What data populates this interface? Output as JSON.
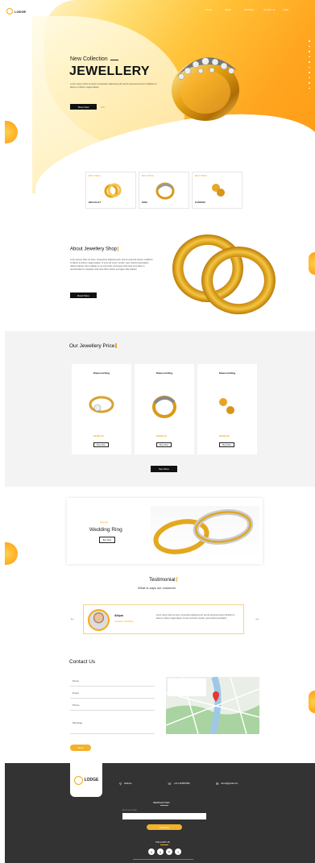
{
  "header": {
    "logo_text": "LODGE",
    "nav": [
      "Home",
      "About",
      "Jewellery",
      "Contact us",
      "Login"
    ]
  },
  "hero": {
    "small_title": "New Collection",
    "title": "JEWELLERY",
    "description": "Lorem ipsum dolor sit amet consectetur adipiscing elit sed do eiusmod tempor incididunt ut labore et dolore magna aliqua",
    "button": "Shop Now",
    "link": "Gift"
  },
  "categories": [
    {
      "top": "BEST PRICE",
      "name": "BRACELET"
    },
    {
      "top": "BEST PRICE",
      "name": "RING"
    },
    {
      "top": "BEST PRICE",
      "name": "EARRING"
    }
  ],
  "about": {
    "title": "About Jewellery Shop",
    "description": "Lorem ipsum dolor sit amet, consectetur adipiscing elit, sed do eiusmod tempor incididunt ut labore et dolore magna aliqua. Ut enim ad minim veniam, quis nostrud exercitation ullamco laboris nisi ut aliquip ex ea commodo consequat. Duis aute irure dolor in reprehenderit in voluptate velit esse cillum dolore eu fugiat nulla pariatur.",
    "button": "Read More"
  },
  "prices": {
    "title": "Our Jewellery Price",
    "items": [
      {
        "name": "Diamond Ring",
        "price": "$1000.00",
        "button": "Buy Now"
      },
      {
        "name": "Diamond Ring",
        "price": "$1000.00",
        "button": "Buy Now"
      },
      {
        "name": "Diamond Ring",
        "price": "$1000.00",
        "button": "Buy Now"
      }
    ],
    "see_more": "See More"
  },
  "wedding": {
    "small": "Special",
    "title": "Wedding Ring",
    "button": "Buy Now"
  },
  "testimonial": {
    "title": "Testimonial",
    "subtitle": "What is says our customer",
    "name": "Aliqua",
    "role": "Jewellery Wedding",
    "text": "Lorem ipsum dolor sit amet, consectetur adipiscing elit, sed do eiusmod tempor incididunt ut labore et dolore magna aliqua. Ut enim ad minim veniam, quis nostrud exercitation"
  },
  "contact": {
    "title": "Contact Us",
    "fields": [
      "Name",
      "Email",
      "Phone",
      "Message"
    ],
    "send": "Send"
  },
  "footer": {
    "logo_text": "LODGE",
    "address": "Address",
    "phone": "+01 1234567890",
    "email": "demo@gmail.com",
    "newsletter": "NEWSLETTER",
    "newsletter_hint": "Enter your email",
    "subscribe": "Subscribe",
    "follow": "FOLLOW US",
    "social": [
      "f",
      "t",
      "in",
      "i"
    ]
  },
  "colors": {
    "accent": "#f4a81a",
    "dark": "#333333",
    "hero_orange": "#ff9b14"
  }
}
